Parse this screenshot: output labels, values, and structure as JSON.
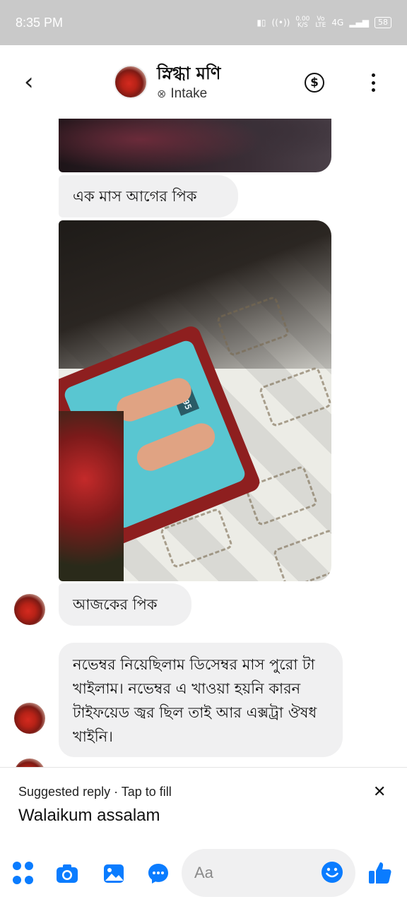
{
  "status_bar": {
    "time": "8:35 PM",
    "net_speed_value": "0.00",
    "net_speed_unit": "K/S",
    "volte": "Vo\nLTE",
    "network": "4G",
    "battery": "58"
  },
  "header": {
    "contact_name": "স্নিগ্ধা মণি",
    "contact_status": "Intake"
  },
  "messages": [
    {
      "text": "এক মাস আগের পিক"
    },
    {
      "text": "আজকের পিক"
    },
    {
      "text": "নভেম্বর নিয়েছিলাম ডিসেম্বর মাস পুরো টা খাইলাম। নভেম্বর এ খাওয়া হয়নি কারন টাইফয়েড জ্বর ছিল তাই আর এক্সট্রা ঔষধ  খাইনি।"
    }
  ],
  "photo_scale_reading": "5.95",
  "suggested": {
    "title": "Suggested reply · Tap to fill",
    "reply": "Walaikum assalam"
  },
  "composer": {
    "placeholder": "Aa"
  },
  "colors": {
    "accent": "#0a7cff",
    "bubble": "#f0f0f1",
    "status_bar": "#c9c9c9"
  }
}
